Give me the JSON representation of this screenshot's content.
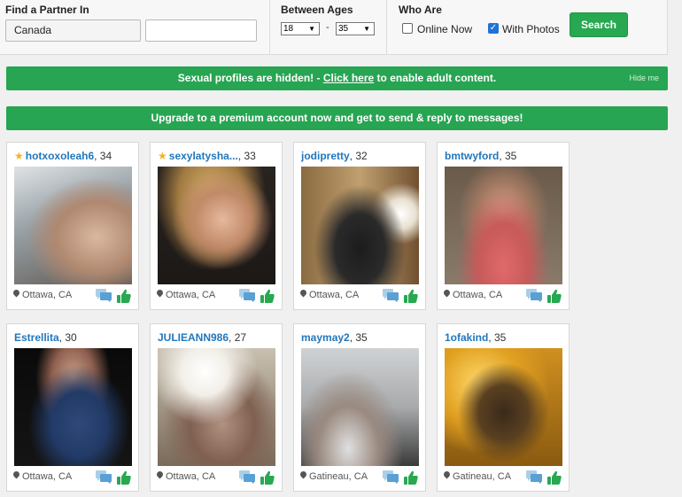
{
  "search": {
    "partner_label": "Find a Partner In",
    "country_value": "Canada",
    "city_value": "",
    "ages_label": "Between Ages",
    "age_min": "18",
    "age_sep": "-",
    "age_max": "35",
    "who_label": "Who Are",
    "online_now_label": "Online Now",
    "online_now_checked": false,
    "with_photos_label": "With Photos",
    "with_photos_checked": true,
    "search_button": "Search"
  },
  "banners": {
    "adult_text_before": "Sexual profiles are hidden! - ",
    "adult_link": "Click here",
    "adult_text_after": " to enable adult content.",
    "hide_me": "Hide me",
    "upgrade_text": "Upgrade to a premium account now and get to send & reply to messages!"
  },
  "colors": {
    "accent_green": "#28a850",
    "username_blue": "#2277bb",
    "star_gold": "#f0b428",
    "chat_icon_blue": "#7fb6dc"
  },
  "profiles": [
    {
      "name": "hotxoxoleah6",
      "age": ", 34",
      "location": "Ottawa, CA",
      "featured": true
    },
    {
      "name": "sexylatysha...",
      "age": ", 33",
      "location": "Ottawa, CA",
      "featured": true
    },
    {
      "name": "jodipretty",
      "age": ", 32",
      "location": "Ottawa, CA",
      "featured": false
    },
    {
      "name": "bmtwyford",
      "age": ", 35",
      "location": "Ottawa, CA",
      "featured": false
    },
    {
      "name": "Estrellita",
      "age": ", 30",
      "location": "Ottawa, CA",
      "featured": false
    },
    {
      "name": "JULIEANN986",
      "age": ", 27",
      "location": "Ottawa, CA",
      "featured": false
    },
    {
      "name": "maymay2",
      "age": ", 35",
      "location": "Gatineau, CA",
      "featured": false
    },
    {
      "name": "1ofakind",
      "age": ", 35",
      "location": "Gatineau, CA",
      "featured": false
    }
  ]
}
